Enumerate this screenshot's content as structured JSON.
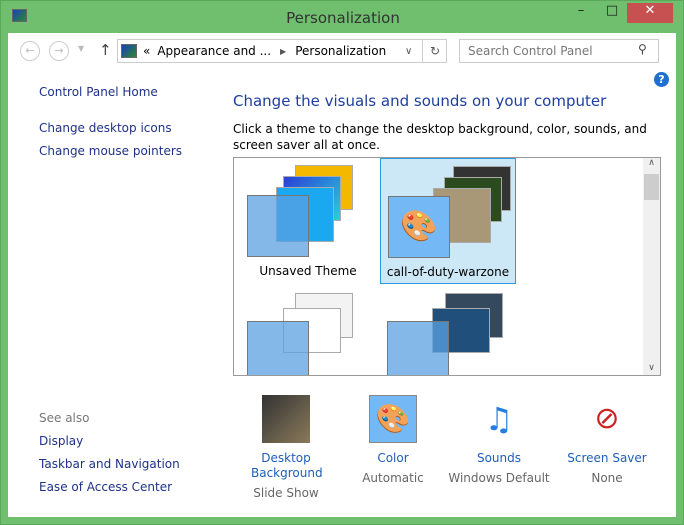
{
  "window": {
    "title": "Personalization",
    "min": "–",
    "max": "□",
    "close": "✕"
  },
  "address": {
    "crumbs": [
      "«",
      "Appearance and ...",
      "Personalization"
    ],
    "search_placeholder": "Search Control Panel"
  },
  "sidebar": {
    "home": "Control Panel Home",
    "links": [
      "Change desktop icons",
      "Change mouse pointers"
    ],
    "see_also": "See also",
    "see_also_links": [
      "Display",
      "Taskbar and Navigation",
      "Ease of Access Center"
    ]
  },
  "main": {
    "heading": "Change the visuals and sounds on your computer",
    "description": "Click a theme to change the desktop background, color, sounds, and screen saver all at once.",
    "themes": [
      {
        "name": "Unsaved Theme"
      },
      {
        "name": "call-of-duty-warzone",
        "selected": true
      },
      {
        "name": ""
      },
      {
        "name": ""
      }
    ],
    "options": [
      {
        "label": "Desktop Background",
        "value": "Slide Show"
      },
      {
        "label": "Color",
        "value": "Automatic"
      },
      {
        "label": "Sounds",
        "value": "Windows Default"
      },
      {
        "label": "Screen Saver",
        "value": "None"
      }
    ]
  }
}
